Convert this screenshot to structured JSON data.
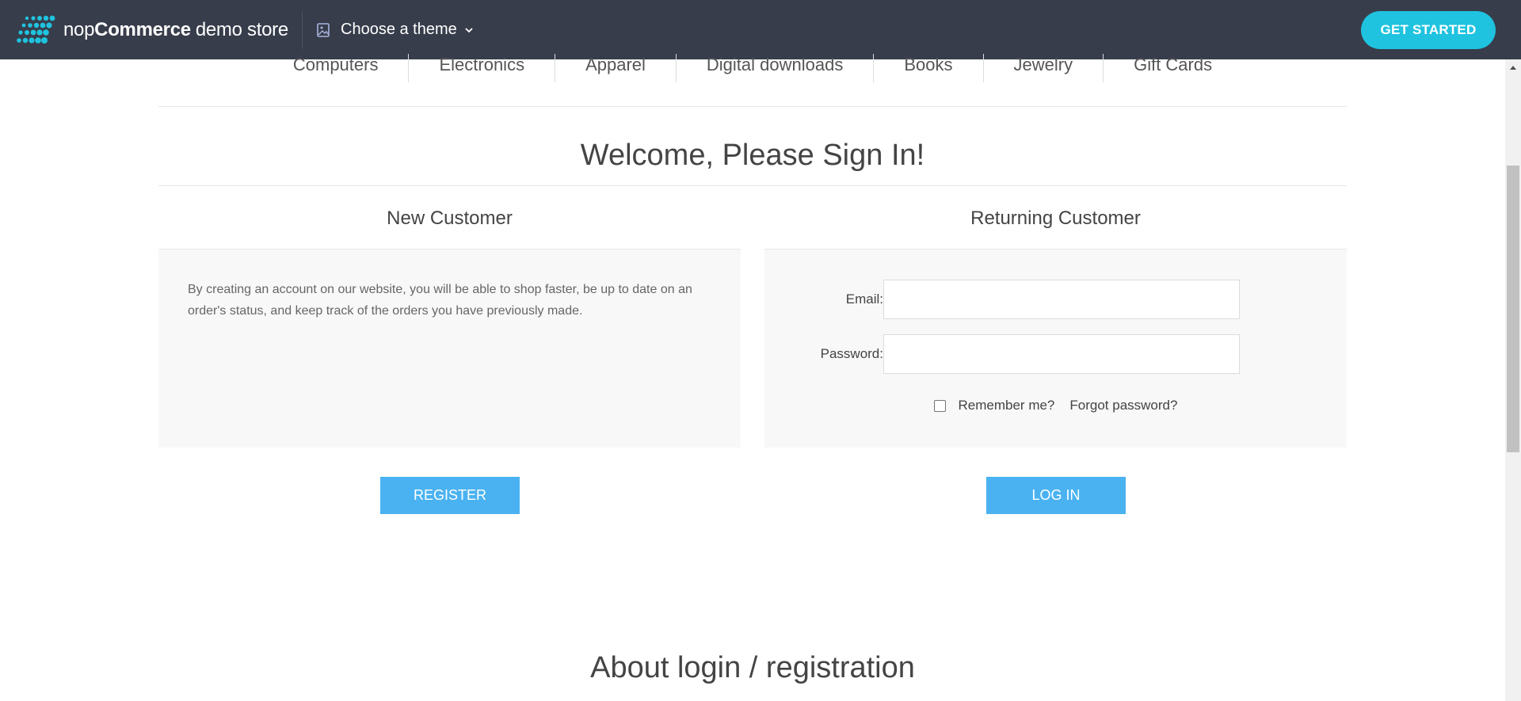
{
  "topbar": {
    "brand_prefix": "nop",
    "brand_bold": "Commerce",
    "brand_suffix": "demo store",
    "theme_picker_label": "Choose a theme",
    "get_started_label": "GET STARTED",
    "background_color": "#373d4b",
    "accent_color": "#1fc3df"
  },
  "categories": [
    "Computers",
    "Electronics",
    "Apparel",
    "Digital downloads",
    "Books",
    "Jewelry",
    "Gift Cards"
  ],
  "page": {
    "title": "Welcome, Please Sign In!",
    "about_title": "About login / registration"
  },
  "new_customer": {
    "title": "New Customer",
    "text": "By creating an account on our website, you will be able to shop faster, be up to date on an order's status, and keep track of the orders you have previously made.",
    "register_label": "REGISTER"
  },
  "returning_customer": {
    "title": "Returning Customer",
    "email_label": "Email:",
    "email_value": "",
    "password_label": "Password:",
    "password_value": "",
    "remember_label": "Remember me?",
    "remember_checked": false,
    "forgot_label": "Forgot password?",
    "login_label": "LOG IN"
  },
  "colors": {
    "button": "#4ab2f1",
    "panel": "#f8f8f8"
  }
}
